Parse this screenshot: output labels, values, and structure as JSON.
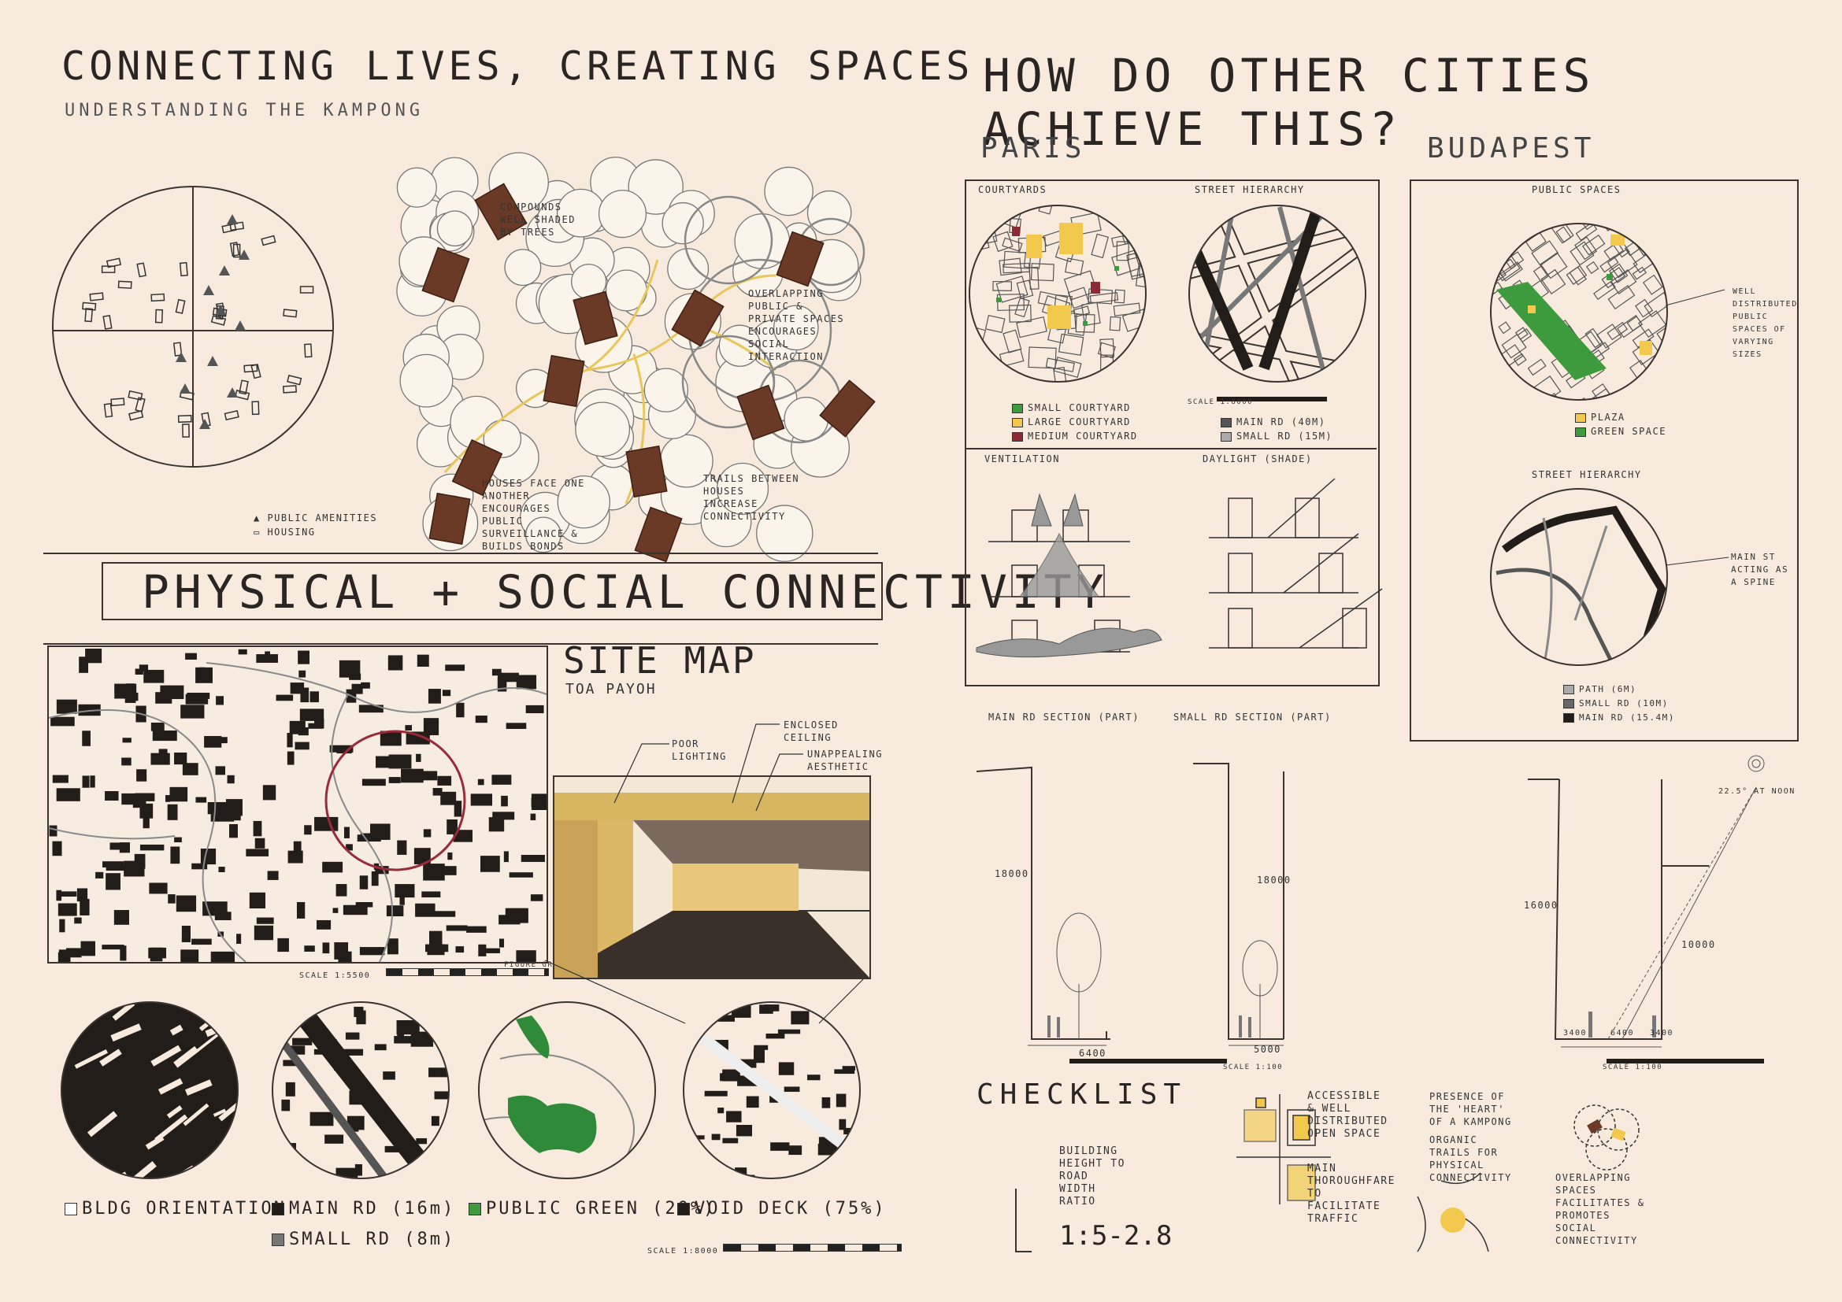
{
  "left": {
    "title": "CONNECTING LIVES, CREATING SPACES",
    "subtitle": "UNDERSTANDING THE KAMPONG",
    "kampong_notes": [
      "COMPOUNDS WELL SHADED BY TREES",
      "OVERLAPPING PUBLIC & PRIVATE SPACES ENCOURAGES SOCIAL INTERACTION",
      "HOUSES FACE ONE ANOTHER ENCOURAGES PUBLIC SURVEILLANCE & BUILDS BONDS",
      "TRAILS BETWEEN HOUSES INCREASE CONNECTIVITY"
    ],
    "kampong_legend": [
      "PUBLIC AMENITIES",
      "HOUSING"
    ],
    "banner": "PHYSICAL + SOCIAL CONNECTIVITY",
    "site_map_title": "SITE MAP",
    "site_map_sub": "TOA PAYOH",
    "site_scale": "SCALE 1:5500",
    "site_scale_note": "FIGURE GROUND",
    "perspective_notes": [
      "POOR LIGHTING",
      "ENCLOSED CEILING",
      "UNAPPEALING AESTHETIC"
    ],
    "legend": {
      "bldg": "BLDG ORIENTATION",
      "main_rd": "MAIN RD (16m)",
      "small_rd": "SMALL RD (8m)",
      "green": "PUBLIC GREEN (20%)",
      "void": "VOID DECK (75%)"
    },
    "bottom_scale": "SCALE 1:8000"
  },
  "right": {
    "title": "HOW DO OTHER CITIES ACHIEVE THIS?",
    "paris": {
      "name": "PARIS",
      "courtyards": "COURTYARDS",
      "street_hierarchy": "STREET HIERARCHY",
      "scale": "SCALE 1:8000",
      "court_legend": [
        "SMALL COURTYARD",
        "LARGE COURTYARD",
        "MEDIUM COURTYARD"
      ],
      "street_legend": [
        "MAIN RD (40m)",
        "SMALL RD (15m)"
      ],
      "ventilation": "VENTILATION",
      "daylight": "DAYLIGHT (SHADE)"
    },
    "budapest": {
      "name": "BUDAPEST",
      "public_spaces": "PUBLIC SPACES",
      "ps_note": "WELL DISTRIBUTED PUBLIC SPACES OF VARYING SIZES",
      "ps_legend": [
        "PLAZA",
        "GREEN SPACE"
      ],
      "street_hierarchy": "STREET HIERARCHY",
      "sh_note": "MAIN ST ACTING AS A SPINE",
      "sh_legend": [
        "PATH (6m)",
        "SMALL RD (10m)",
        "MAIN RD (15.4m)"
      ]
    },
    "sections": {
      "main_rd": "MAIN RD SECTION (PART)",
      "small_rd": "SMALL RD SECTION (PART)",
      "h1": "18000",
      "w1": "6400",
      "h2": "18000",
      "w2": "5000",
      "scale": "SCALE 1:100",
      "bp_h": "16000",
      "bp_h2": "10000",
      "bp_w": [
        "3400",
        "6400",
        "3400"
      ],
      "sun": "22.5° AT NOON",
      "scale2": "SCALE 1:100"
    },
    "checklist": {
      "title": "CHECKLIST",
      "ratio_label": "BUILDING HEIGHT TO ROAD WIDTH RATIO",
      "ratio": "1:5-2.8",
      "items": [
        "ACCESSIBLE & WELL DISTRIBUTED OPEN SPACE",
        "MAIN THOROUGHFARE TO FACILITATE TRAFFIC",
        "PRESENCE OF THE 'HEART' OF A KAMPONG",
        "ORGANIC TRAILS FOR PHYSICAL CONNECTIVITY",
        "OVERLAPPING SPACES FACILITATES & PROMOTES SOCIAL CONNECTIVITY"
      ]
    }
  },
  "colors": {
    "paper": "#f8ebde",
    "ink": "#2a2522",
    "roof": "#6b3a26",
    "yellow": "#f2c94c",
    "green": "#3d9a3d",
    "maroon": "#8a2a34",
    "grey": "#888888"
  }
}
